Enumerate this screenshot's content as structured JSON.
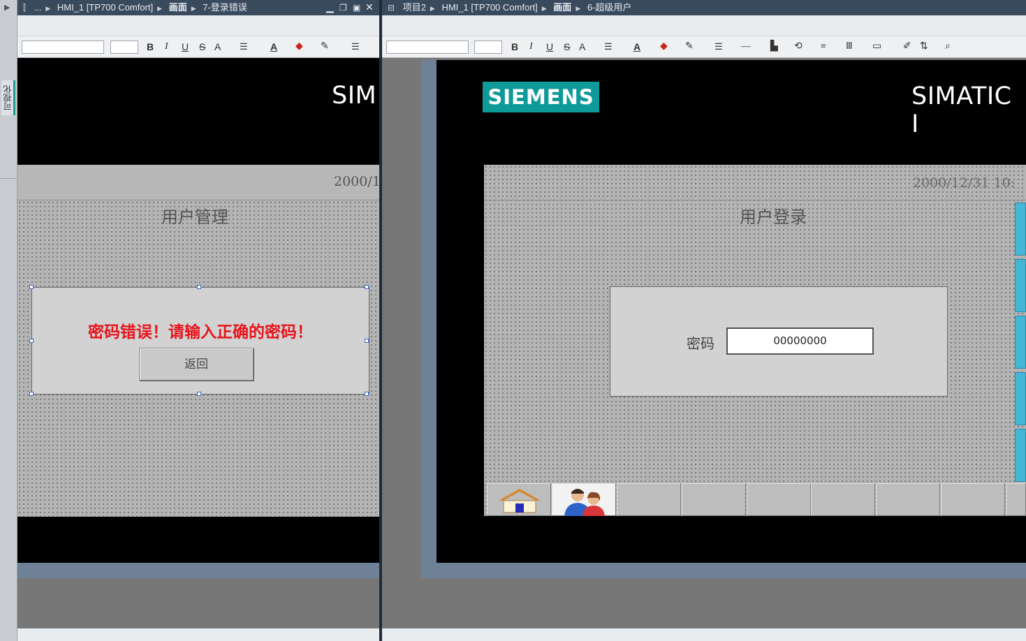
{
  "left_window": {
    "breadcrumb": [
      "...",
      "HMI_1 [TP700 Comfort]",
      "画面",
      "7-登录错误"
    ],
    "hmi": {
      "brand_text": "SIM",
      "date": "2000/1",
      "screen_title": "用户管理",
      "error_message": "密码错误！请输入正确的密码！",
      "return_button": "返回"
    }
  },
  "right_window": {
    "breadcrumb": [
      "项目2",
      "HMI_1 [TP700 Comfort]",
      "画面",
      "6-超级用户"
    ],
    "hmi": {
      "logo": "SIEMENS",
      "brand_text": "SIMATIC I",
      "date": "2000/12/31 10:",
      "screen_title": "用户登录",
      "password_label": "密码",
      "password_value": "00000000"
    }
  },
  "sidebar": {
    "tab_label": "可视化"
  },
  "toolbar": {
    "bold": "B",
    "italic": "I",
    "underline": "U",
    "strike": "S",
    "grow": "A"
  },
  "colors": {
    "accent": "#0f9a9a",
    "error_text": "#e8141b",
    "titlebar": "#3a4a5d"
  }
}
